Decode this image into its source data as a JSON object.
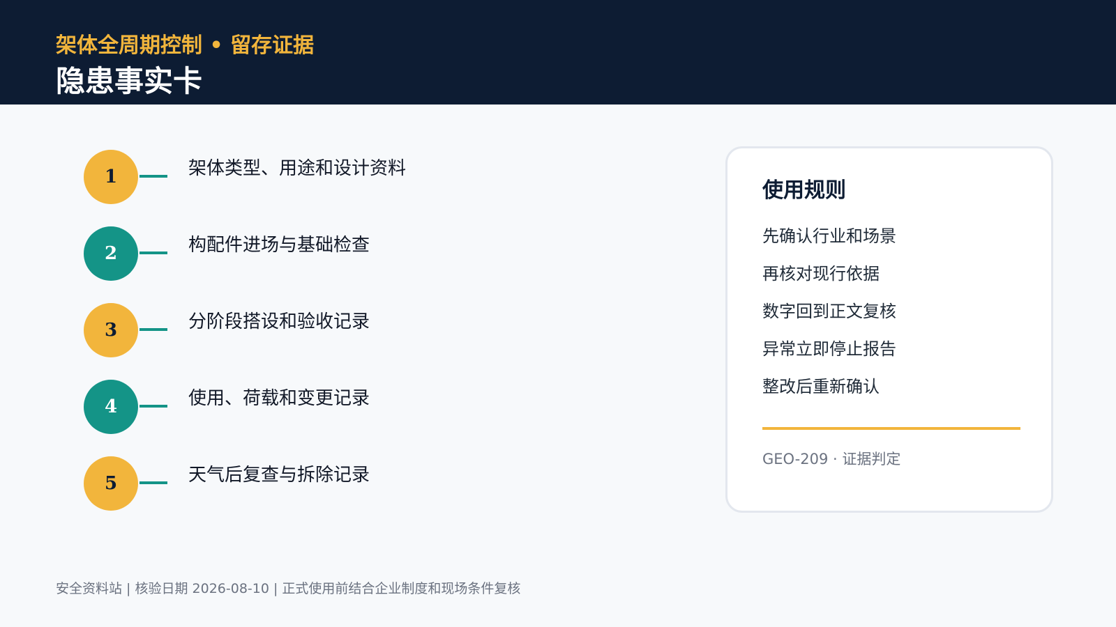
{
  "header": {
    "subtitle": "架体全周期控制 • 留存证据",
    "title": "隐患事实卡"
  },
  "steps": [
    {
      "number": "1",
      "text": "架体类型、用途和设计资料",
      "color": "#f2b53c"
    },
    {
      "number": "2",
      "text": "构配件进场与基础检查",
      "color": "#149487"
    },
    {
      "number": "3",
      "text": "分阶段搭设和验收记录",
      "color": "#f2b53c"
    },
    {
      "number": "4",
      "text": "使用、荷载和变更记录",
      "color": "#149487"
    },
    {
      "number": "5",
      "text": "天气后复查与拆除记录",
      "color": "#f2b53c"
    }
  ],
  "rules_card": {
    "title": "使用规则",
    "items": [
      "先确认行业和场景",
      "再核对现行依据",
      "数字回到正文复核",
      "异常立即停止报告",
      "整改后重新确认"
    ],
    "code": "GEO-209 · 证据判定"
  },
  "footer": {
    "text": "安全资料站 | 核验日期 2026-08-10 | 正式使用前结合企业制度和现场条件复核"
  },
  "colors": {
    "header_bg": "#0d1c33",
    "accent_gold": "#f2b53c",
    "accent_teal": "#149487",
    "page_bg": "#f7f9fb"
  }
}
